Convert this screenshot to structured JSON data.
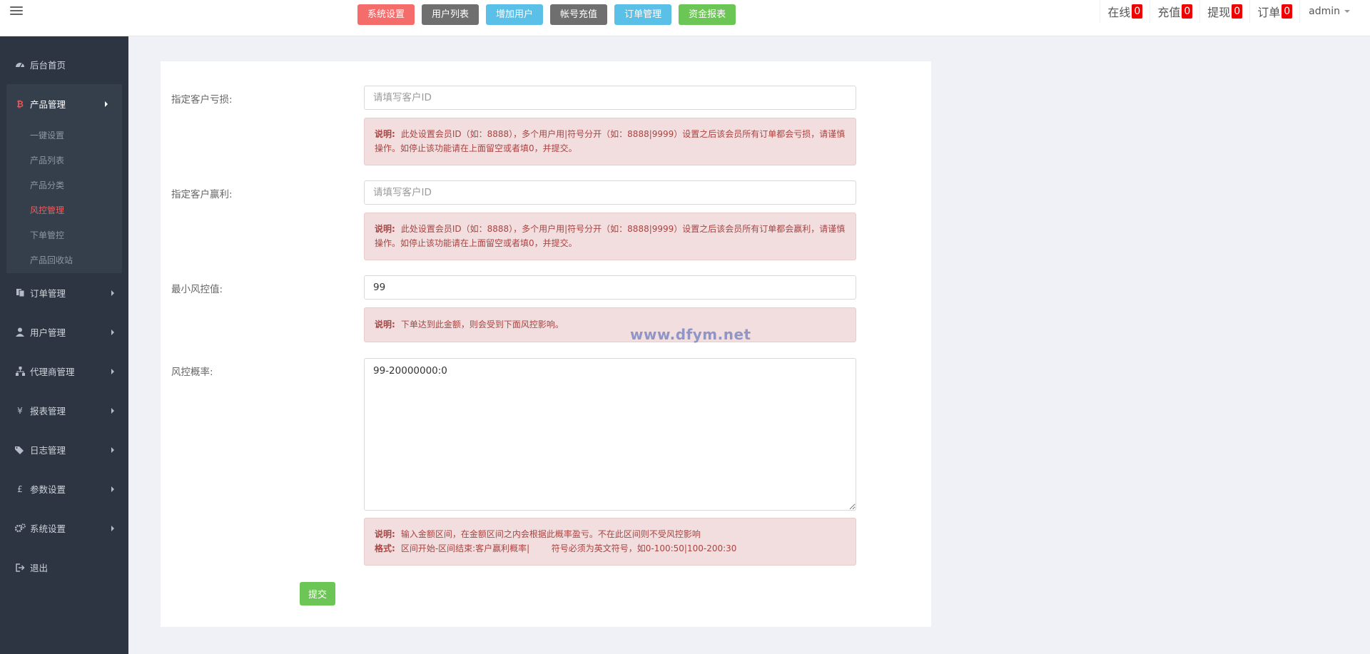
{
  "topbar": {
    "buttons": [
      {
        "label": "系统设置",
        "color": "#f56d6b"
      },
      {
        "label": "用户列表",
        "color": "#6f6f6f"
      },
      {
        "label": "增加用户",
        "color": "#5bc0e8"
      },
      {
        "label": "帐号充值",
        "color": "#6f6f6f"
      },
      {
        "label": "订单管理",
        "color": "#5bc0e8"
      },
      {
        "label": "资金报表",
        "color": "#6cc655"
      }
    ],
    "stats": [
      {
        "label": "在线",
        "count": "0"
      },
      {
        "label": "充值",
        "count": "0"
      },
      {
        "label": "提现",
        "count": "0"
      },
      {
        "label": "订单",
        "count": "0"
      }
    ],
    "user": "admin"
  },
  "sidebar": {
    "home": "后台首页",
    "product": "产品管理",
    "product_subs": [
      "一键设置",
      "产品列表",
      "产品分类",
      "风控管理",
      "下单管控",
      "产品回收站"
    ],
    "items": [
      "订单管理",
      "用户管理",
      "代理商管理",
      "报表管理",
      "日志管理",
      "参数设置",
      "系统设置"
    ],
    "logout": "退出"
  },
  "form": {
    "loss": {
      "label": "指定客户亏损:",
      "placeholder": "请填写客户ID",
      "note_title": "说明:",
      "note_text": "此处设置会员ID（如：8888），多个用户用|符号分开（如：8888|9999）设置之后该会员所有订单都会亏损，请谨慎操作。如停止该功能请在上面留空或者填0，并提交。"
    },
    "win": {
      "label": "指定客户赢利:",
      "placeholder": "请填写客户ID",
      "note_title": "说明:",
      "note_text": "此处设置会员ID（如：8888），多个用户用|符号分开（如：8888|9999）设置之后该会员所有订单都会赢利，请谨慎操作。如停止该功能请在上面留空或者填0，并提交。"
    },
    "min": {
      "label": "最小风控值:",
      "value": "99",
      "note_title": "说明:",
      "note_text": "下单达到此金额，则会受到下面风控影响。"
    },
    "rate": {
      "label": "风控概率:",
      "value": "99-20000000:0",
      "note_title": "说明:",
      "note_text": "输入金额区间，在金额区间之内会根据此概率盈亏。不在此区间则不受风控影响",
      "format_title": "格式:",
      "format_text": "区间开始-区间结束:客户赢利概率|        符号必须为英文符号，如0-100:50|100-200:30"
    },
    "submit": "提交"
  },
  "watermark": "www.dfym.net"
}
